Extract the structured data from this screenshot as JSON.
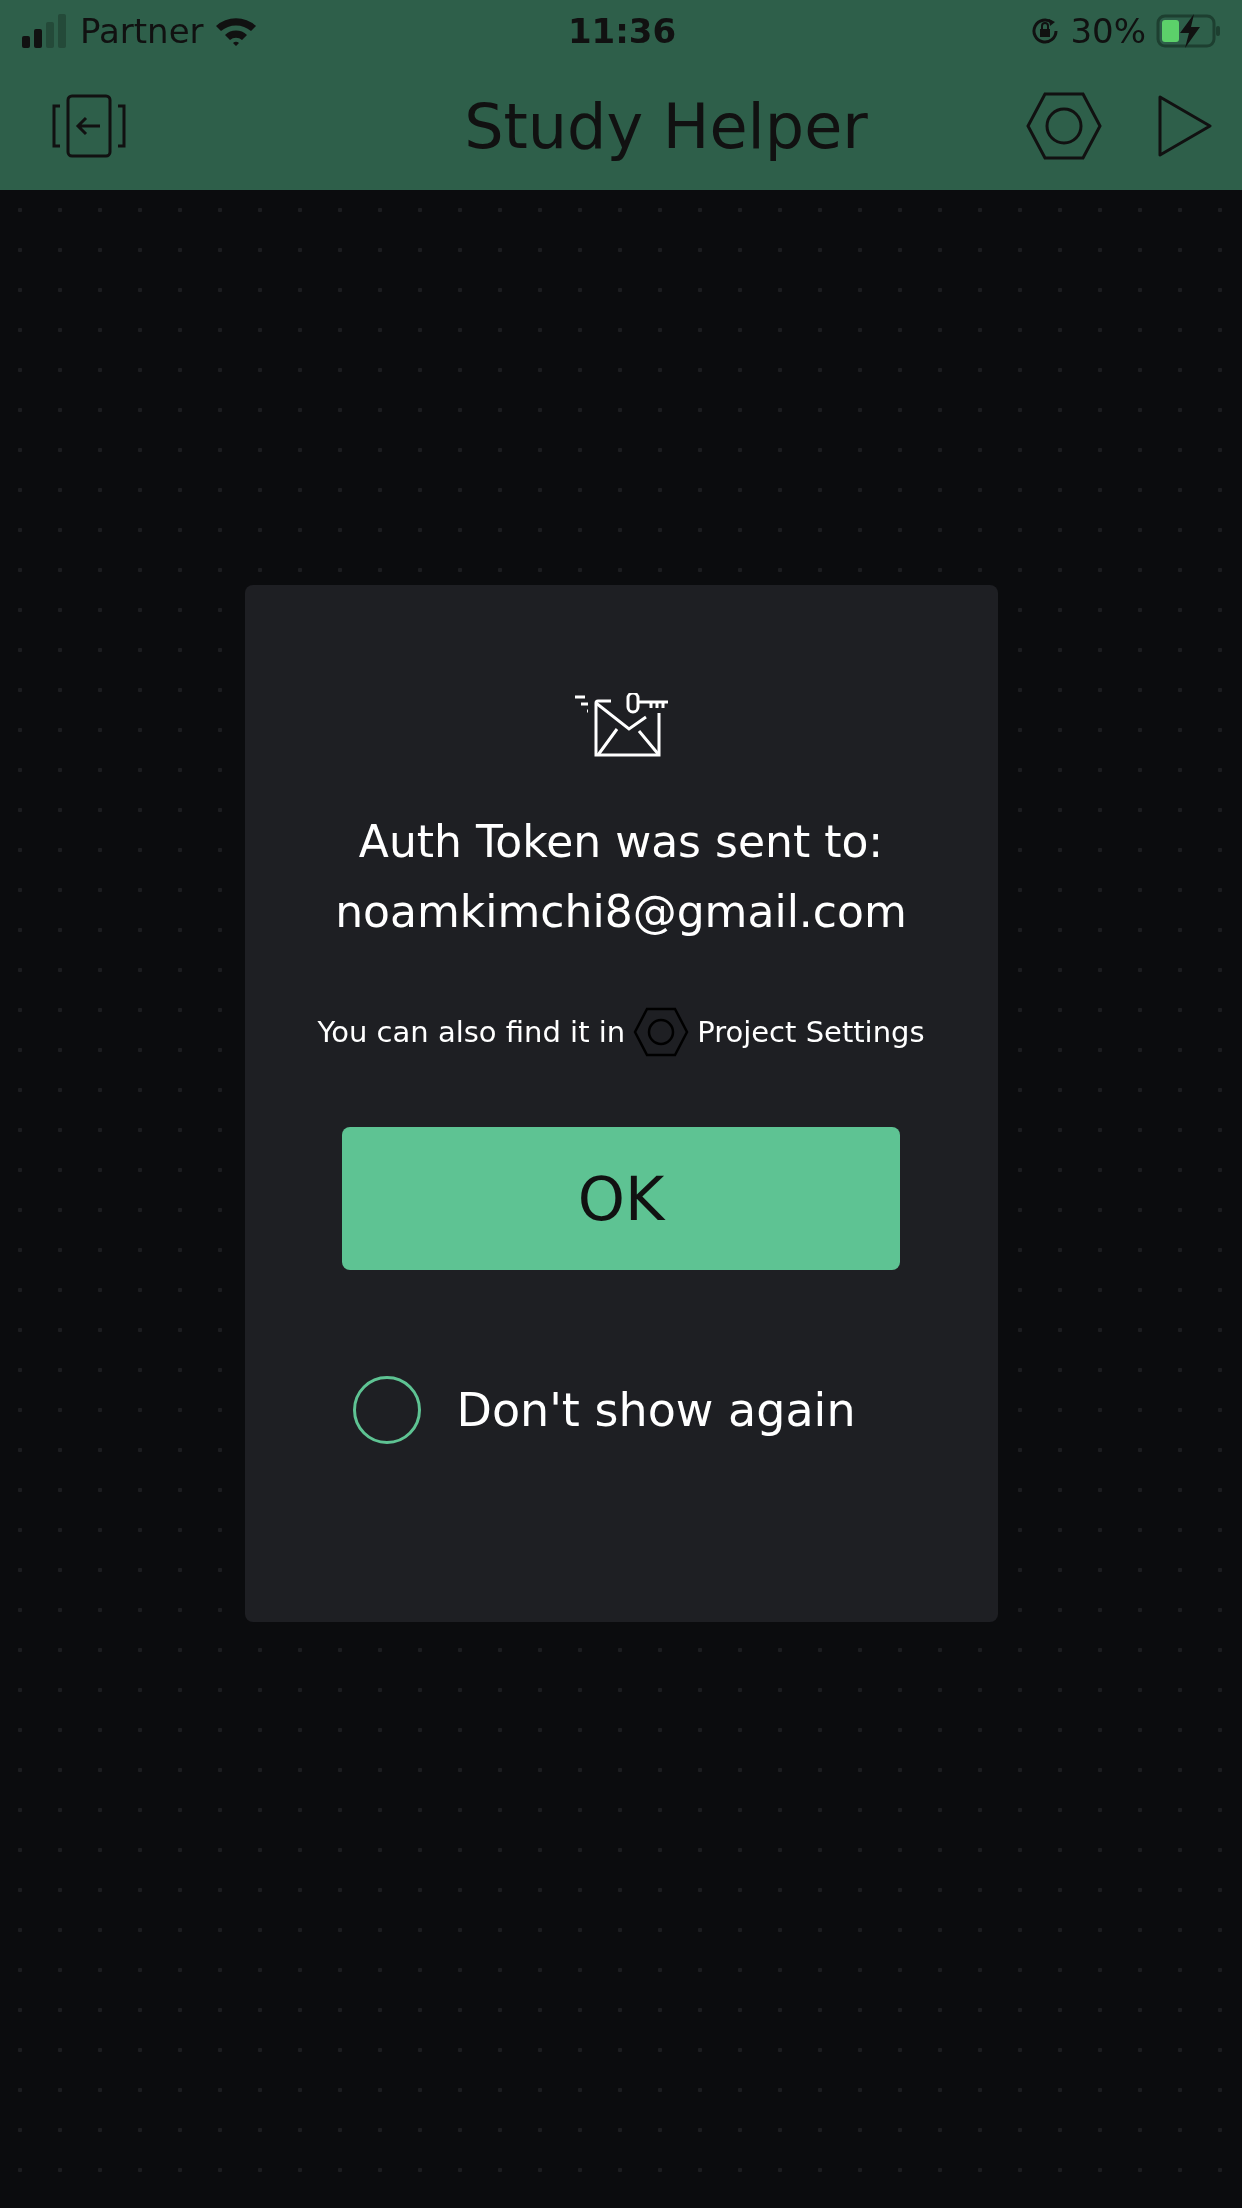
{
  "status_bar": {
    "carrier": "Partner",
    "time": "11:36",
    "battery": "30%",
    "charging": true
  },
  "header": {
    "title": "Study Helper"
  },
  "dialog": {
    "title": "Auth Token was sent to:",
    "email": "noamkimchi8@gmail.com",
    "hint_before": "You can also find it in",
    "hint_after": "Project Settings",
    "ok_button": "OK",
    "dont_show": {
      "label": "Don't show again",
      "checked": false
    }
  }
}
